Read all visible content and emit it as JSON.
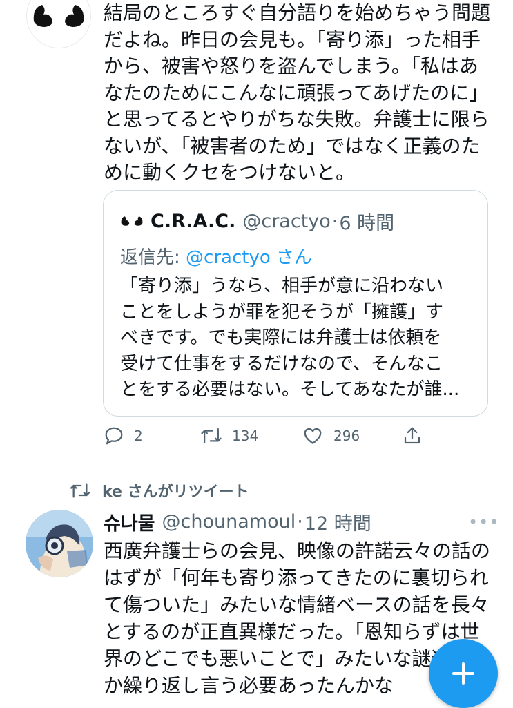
{
  "tweet1": {
    "text": "結局のところすぐ自分語りを始めちゃう問題\nだよね。昨日の会見も。「寄り添」った相手\nから、被害や怒りを盗んでしまう。「私はあ\nなたのためにこんなに頑張ってあげたのに」\nと思ってるとやりがちな失敗。弁護士に限ら\nないが、「被害者のため」ではなく正義のた\nめに動くクセをつけないと。",
    "quote": {
      "name": "C.R.A.C.",
      "handle": "@cractyo",
      "dot": "·",
      "time": "6 時間",
      "reply_prefix": "返信先: ",
      "reply_mention": "@cractyo",
      "reply_suffix": " さん",
      "text": "「寄り添」うなら、相手が意に沿わない\nことをしようが罪を犯そうが「擁護」す\nべきです。でも実際には弁護士は依頼を\n受けて仕事をするだけなので、そんなこ\nとをする必要はない。そしてあなたが誰..."
    },
    "actions": {
      "reply_count": "2",
      "retweet_count": "134",
      "like_count": "296"
    }
  },
  "retweet_banner": "ke さんがリツイート",
  "tweet2": {
    "name": "슈나물",
    "handle": "@chounamoul",
    "dot": "·",
    "time": "12 時間",
    "more": "•••",
    "text": "西廣弁護士らの会見、映像の許諾云々の話の\nはずが「何年も寄り添ってきたのに裏切られ\nて傷ついた」みたいな情緒ベースの話を長々\nとするのが正直異様だった。「恩知らずは世\n界のどこでも悪いことで」みたいな謎道徳\nか繰り返し言う必要あったんかな"
  },
  "colors": {
    "accent": "#1d9bf0",
    "secondary_text": "#536471",
    "border": "#cfd9de"
  },
  "icons": [
    "logo-hands-icon",
    "reply-icon",
    "retweet-icon",
    "like-icon",
    "share-icon",
    "compose-plus-icon",
    "more-icon"
  ]
}
